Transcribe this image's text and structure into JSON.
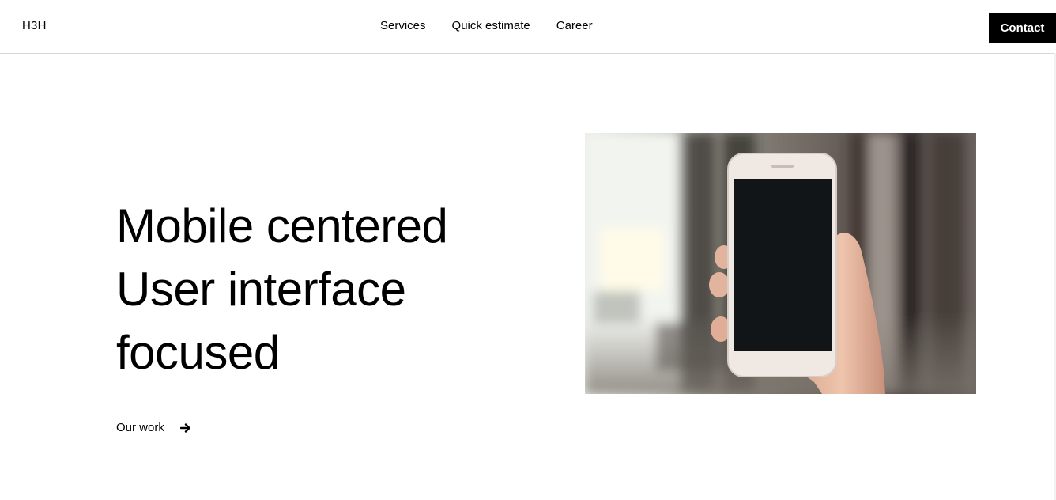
{
  "header": {
    "logo": "H3H",
    "nav": [
      {
        "label": "Services"
      },
      {
        "label": "Quick estimate"
      },
      {
        "label": "Career"
      }
    ],
    "contact_label": "Contact"
  },
  "hero": {
    "title_lines": [
      "Mobile centered",
      "User interface",
      "focused"
    ],
    "cta_label": "Our work",
    "cta_icon": "arrow-right-icon"
  },
  "image": {
    "subject": "photo-hand-holding-smartphone",
    "accent_colors": {
      "screen": "#111517",
      "phone_body": "#efe7e2",
      "skin": "#e6b79e"
    }
  }
}
